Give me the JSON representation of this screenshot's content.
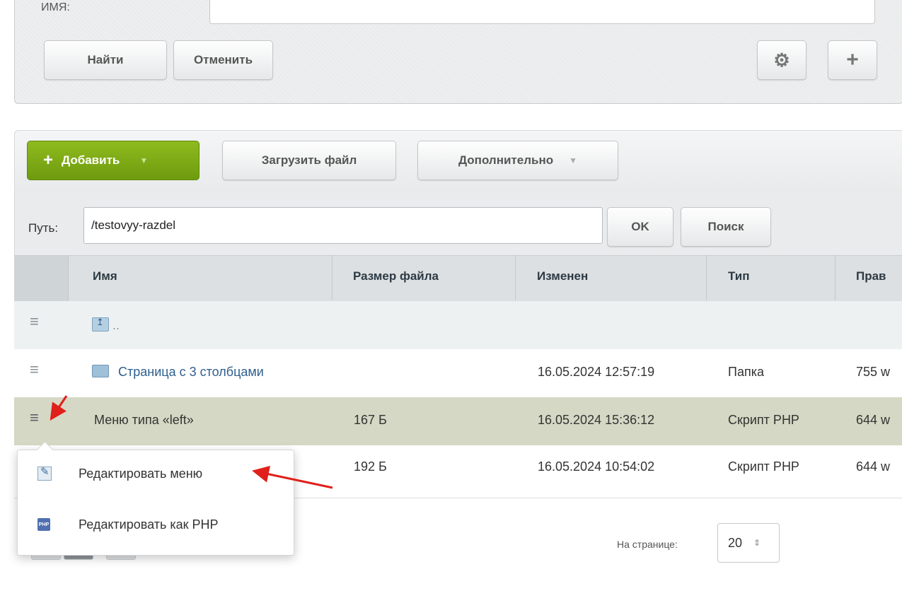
{
  "filter": {
    "field_label": "Имя:",
    "find_label": "Найти",
    "cancel_label": "Отменить",
    "settings_icon": "gear-icon",
    "add_filter_icon": "plus-icon"
  },
  "toolbar": {
    "add_label": "Добавить",
    "upload_label": "Загрузить файл",
    "more_label": "Дополнительно"
  },
  "path": {
    "label": "Путь:",
    "value": "/testovyy-razdel",
    "ok_label": "OK",
    "search_label": "Поиск"
  },
  "table": {
    "headers": [
      "Имя",
      "Размер файла",
      "Изменен",
      "Тип",
      "Прав"
    ],
    "rows": [
      {
        "name": "..",
        "size": "",
        "modified": "",
        "type": "",
        "perms": ""
      },
      {
        "name": "Страница с 3 столбцами",
        "size": "",
        "modified": "16.05.2024 12:57:19",
        "type": "Папка",
        "perms": "755 w"
      },
      {
        "name": "Меню типа «left»",
        "size": "167 Б",
        "modified": "16.05.2024 15:36:12",
        "type": "Скрипт PHP",
        "perms": "644 w"
      },
      {
        "name": "",
        "size": "192 Б",
        "modified": "16.05.2024 10:54:02",
        "type": "Скрипт PHP",
        "perms": "644 w"
      }
    ]
  },
  "context_menu": {
    "items": [
      {
        "label": "Редактировать меню",
        "icon": "edit-menu-icon"
      },
      {
        "label": "Редактировать как PHP",
        "icon": "php-icon"
      }
    ]
  },
  "pagination": {
    "per_page_label": "На странице:",
    "per_page_value": "20"
  },
  "colors": {
    "accent_green": "#7aa812",
    "selected_row": "#d5d8c4",
    "link": "#2e5f8e",
    "annotation_red": "#e0201b"
  }
}
